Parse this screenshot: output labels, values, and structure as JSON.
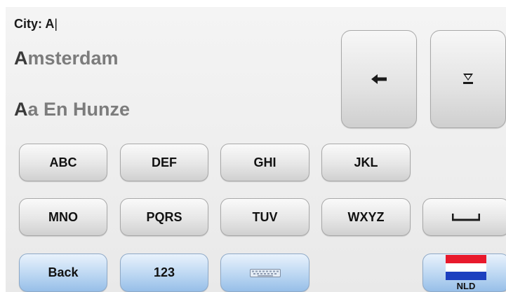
{
  "input": {
    "label": "City: A",
    "cursor": "|"
  },
  "suggestions": [
    {
      "match": "A",
      "rest": "msterdam"
    },
    {
      "match": "A",
      "rest": "a En Hunze"
    }
  ],
  "keys": {
    "row1": [
      "ABC",
      "DEF",
      "GHI",
      "JKL"
    ],
    "row2": [
      "MNO",
      "PQRS",
      "TUV",
      "WXYZ"
    ],
    "back": "Back",
    "numbers": "123",
    "country": "NLD"
  },
  "icons": {
    "backspace": "left-arrow-icon",
    "hide_list": "down-arrow-icon",
    "space": "space-bar-icon",
    "keyboard": "keyboard-icon",
    "flag": "netherlands-flag-icon"
  },
  "colors": {
    "flag_red": "#e8192c",
    "flag_white": "#ffffff",
    "flag_blue": "#1c3fbf",
    "blue_key": "#bcd7f2"
  }
}
